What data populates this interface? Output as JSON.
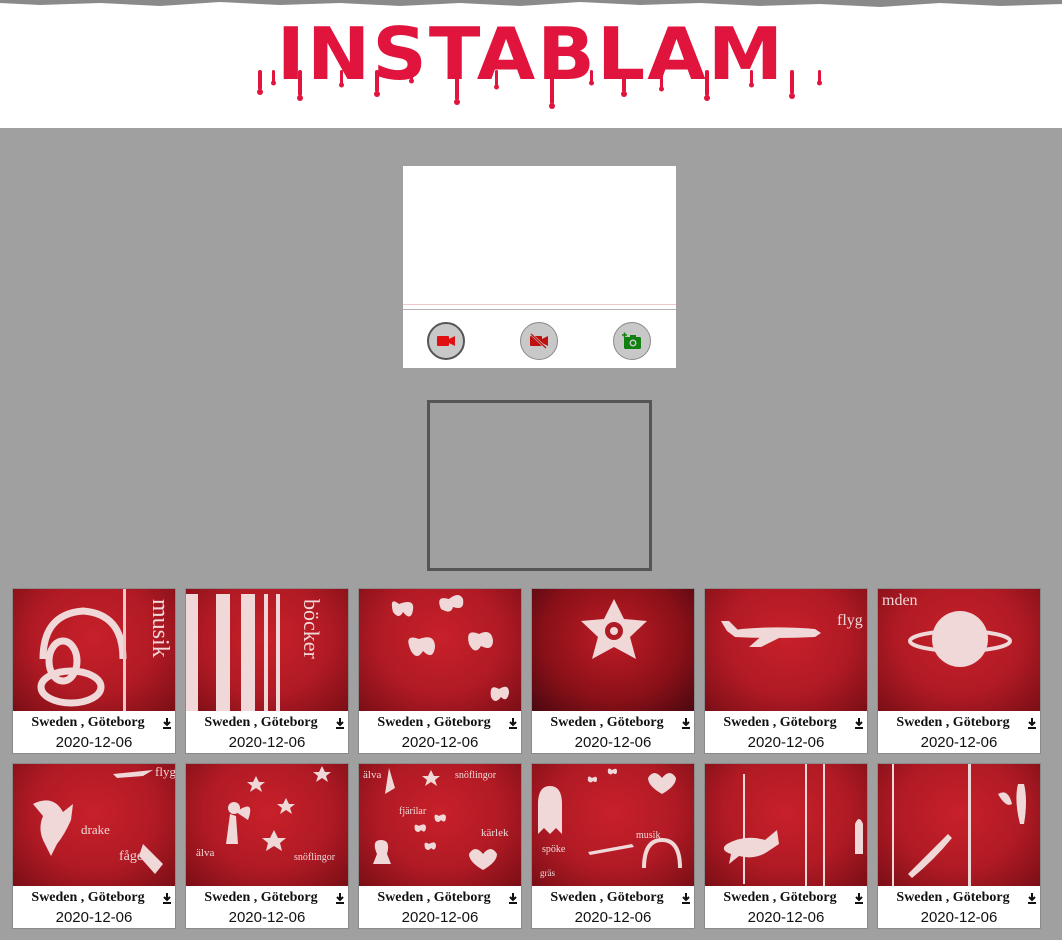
{
  "header": {
    "logo_text": "INSTABLAM",
    "logo_color": "#e0143c"
  },
  "camera": {
    "buttons": [
      {
        "icon": "video-camera-icon",
        "color": "#e01010"
      },
      {
        "icon": "video-off-icon",
        "color": "#c01010"
      },
      {
        "icon": "add-photo-icon",
        "color": "#108010"
      }
    ]
  },
  "gallery": {
    "photos": [
      {
        "location": "Sweden , Göteborg",
        "date": "2020-12-06",
        "subject": "headphones"
      },
      {
        "location": "Sweden , Göteborg",
        "date": "2020-12-06",
        "subject": "books"
      },
      {
        "location": "Sweden , Göteborg",
        "date": "2020-12-06",
        "subject": "butterflies"
      },
      {
        "location": "Sweden , Göteborg",
        "date": "2020-12-06",
        "subject": "snowflake"
      },
      {
        "location": "Sweden , Göteborg",
        "date": "2020-12-06",
        "subject": "airplane"
      },
      {
        "location": "Sweden , Göteborg",
        "date": "2020-12-06",
        "subject": "planet"
      },
      {
        "location": "Sweden , Göteborg",
        "date": "2020-12-06",
        "subject": "dragon"
      },
      {
        "location": "Sweden , Göteborg",
        "date": "2020-12-06",
        "subject": "fairy"
      },
      {
        "location": "Sweden , Göteborg",
        "date": "2020-12-06",
        "subject": "fairy-butterflies"
      },
      {
        "location": "Sweden , Göteborg",
        "date": "2020-12-06",
        "subject": "ghost"
      },
      {
        "location": "Sweden , Göteborg",
        "date": "2020-12-06",
        "subject": "fox"
      },
      {
        "location": "Sweden , Göteborg",
        "date": "2020-12-06",
        "subject": "fern"
      }
    ],
    "photo_texts": {
      "musik": "musik",
      "bocker": "böcker",
      "flyg": "flyg",
      "mden": "mden",
      "drake": "drake",
      "fagel": "fågel",
      "alva": "älva",
      "snofl": "snöflingor",
      "farilar": "fjärilar",
      "karlek": "kärlek",
      "spoke": "spöke",
      "gras": "gräs"
    }
  }
}
